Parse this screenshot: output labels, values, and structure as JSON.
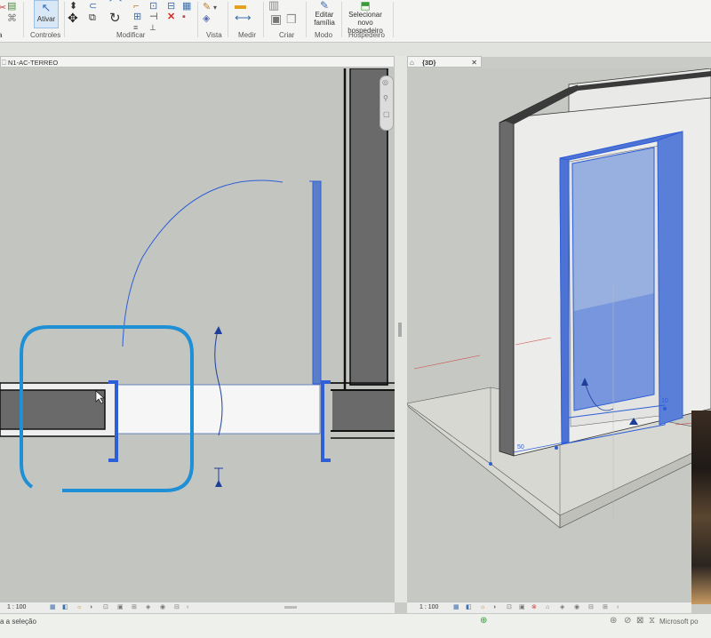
{
  "ribbon": {
    "groups": [
      {
        "id": "controles",
        "label": "Controles"
      },
      {
        "id": "modificar",
        "label": "Modificar"
      },
      {
        "id": "vista",
        "label": "Vista"
      },
      {
        "id": "medir",
        "label": "Medir"
      },
      {
        "id": "criar",
        "label": "Criar"
      },
      {
        "id": "modo",
        "label": "Modo"
      },
      {
        "id": "hospedeiro",
        "label": "Hospedeiro"
      }
    ],
    "buttons": {
      "ativar": "Ativar",
      "editar_familia_1": "Editar",
      "editar_familia_2": "família",
      "selecionar_1": "Selecionar",
      "selecionar_2": "novo hospedeiro",
      "left_cut": "a"
    }
  },
  "tabs": {
    "plan": {
      "label": "N1-AC-TERREO"
    },
    "view3d": {
      "label": "{3D}"
    }
  },
  "plan_view": {
    "scale": "1 : 100"
  },
  "view_3d": {
    "scale": "1 : 100",
    "dimension_labels": [
      "50",
      "10"
    ]
  },
  "statusbar": {
    "left_text": "a a seleção",
    "right_text": "Microsoft po"
  },
  "colors": {
    "selection_blue": "#2f5fd6",
    "highlight_ring": "#1f8fd6",
    "wall_dark": "#6a6a6a",
    "ribbon_bg": "#f4f5f3"
  }
}
